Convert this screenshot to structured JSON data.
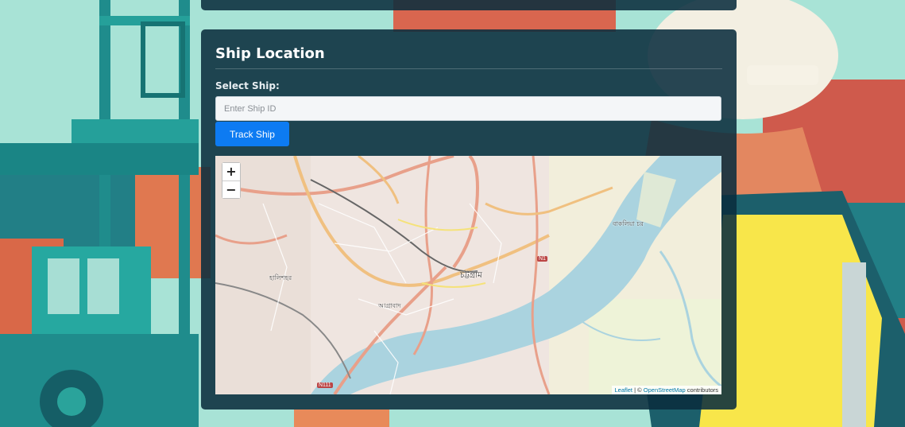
{
  "panel": {
    "title": "Ship Location",
    "select_label": "Select Ship:",
    "input_placeholder": "Enter Ship ID",
    "input_value": "",
    "track_button": "Track Ship"
  },
  "map": {
    "zoom_in": "+",
    "zoom_out": "−",
    "attribution": {
      "leaflet": "Leaflet",
      "separator": " | © ",
      "osm": "OpenStreetMap",
      "suffix": " contributors"
    },
    "labels": {
      "chattogram": "চট্টগ্রাম",
      "halishahar": "হালিশহর",
      "agrabad": "আগ্রাবাদ",
      "bakalia": "বাকলিয়া চর"
    },
    "road_shields": {
      "n1": "N1",
      "n111": "N111"
    }
  },
  "colors": {
    "panel_bg": "#0a2d3e",
    "button_bg": "#0d7bf2",
    "river": "#aad3df"
  }
}
